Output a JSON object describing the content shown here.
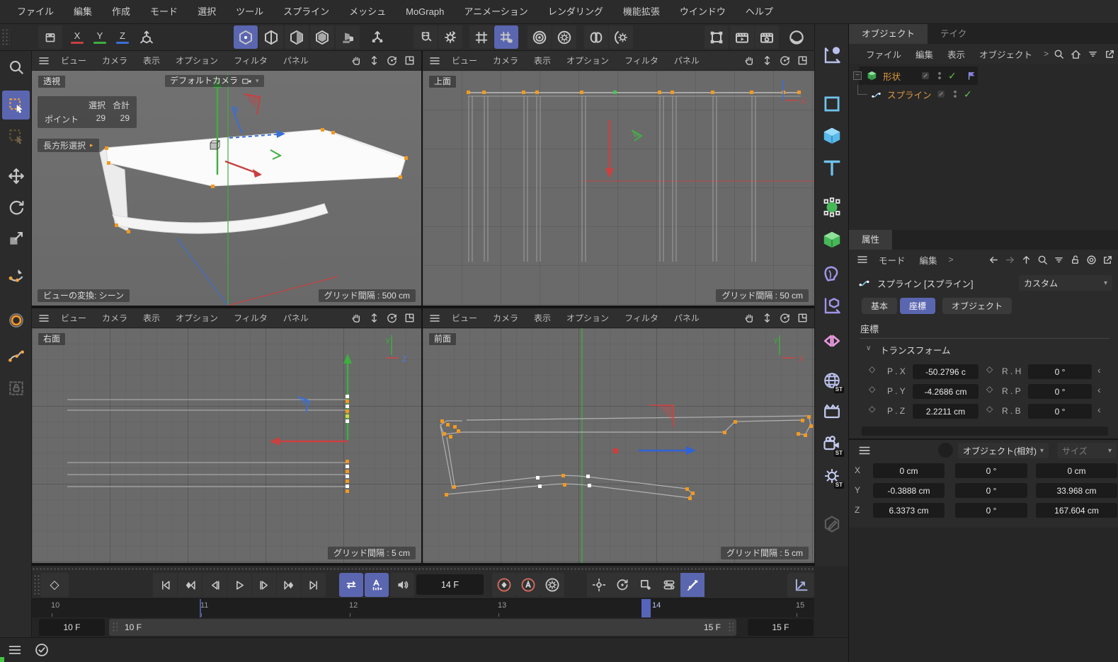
{
  "menubar": {
    "items": [
      "ファイル",
      "編集",
      "作成",
      "モード",
      "選択",
      "ツール",
      "スプライン",
      "メッシュ",
      "MoGraph",
      "アニメーション",
      "レンダリング",
      "機能拡張",
      "ウインドウ",
      "ヘルプ"
    ]
  },
  "viewport_menu": {
    "items": [
      "ビュー",
      "カメラ",
      "表示",
      "オプション",
      "フィルタ",
      "パネル"
    ]
  },
  "viewports": {
    "persp": {
      "label": "透視",
      "camera_label": "デフォルトカメラ",
      "hud_col1": "選択",
      "hud_col2": "合計",
      "hud_row_label": "ポイント",
      "hud_selected": "29",
      "hud_total": "29",
      "tool_label": "長方形選択",
      "status_left": "ビューの変換: シーン",
      "grid_label": "グリッド間隔 : 500 cm"
    },
    "top": {
      "label": "上面",
      "grid_label": "グリッド間隔 : 50 cm"
    },
    "right": {
      "label": "右面",
      "grid_label": "グリッド間隔 : 5 cm"
    },
    "front": {
      "label": "前面",
      "grid_label": "グリッド間隔 : 5 cm"
    },
    "gizmo": {
      "x": "X",
      "y": "Y",
      "z": "Z"
    }
  },
  "object_manager": {
    "tabs": [
      "オブジェクト",
      "テイク"
    ],
    "menu": [
      "ファイル",
      "編集",
      "表示",
      "オブジェクト"
    ],
    "objects": [
      {
        "name": "形状"
      },
      {
        "name": "スプライン"
      }
    ]
  },
  "attribute_manager": {
    "tab": "属性",
    "menu": [
      "モード",
      "編集"
    ],
    "object_title": "スプライン [スプライン]",
    "preset": "カスタム",
    "tabs": [
      "基本",
      "座標",
      "オブジェクト"
    ],
    "active_tab": "座標",
    "section_title": "座標",
    "group_title": "トランスフォーム",
    "pos": [
      {
        "label": "P . X",
        "value": "-50.2796 c"
      },
      {
        "label": "P . Y",
        "value": "-4.2686 cm"
      },
      {
        "label": "P . Z",
        "value": "2.2211 cm"
      }
    ],
    "rot": [
      {
        "label": "R . H",
        "value": "0 °"
      },
      {
        "label": "R . P",
        "value": "0 °"
      },
      {
        "label": "R . B",
        "value": "0 °"
      }
    ]
  },
  "coord_manager": {
    "mode_dropdown": "オブジェクト(相対)",
    "size_dropdown": "サイズ",
    "rows": [
      {
        "axis": "X",
        "position": "0 cm",
        "rotation": "0 °",
        "scale": "0 cm"
      },
      {
        "axis": "Y",
        "position": "-0.3888 cm",
        "rotation": "0 °",
        "scale": "33.968 cm"
      },
      {
        "axis": "Z",
        "position": "6.3373 cm",
        "rotation": "0 °",
        "scale": "167.604 cm"
      }
    ]
  },
  "timeline": {
    "current_frame": "14 F",
    "ticks": [
      "10",
      "11",
      "12",
      "13",
      "14",
      "15"
    ],
    "range_start_field": "10 F",
    "range_end_field": "15 F",
    "range_bar_start": "10 F",
    "range_bar_end": "15 F"
  },
  "badges": {
    "st": "ST"
  },
  "glyphs": {
    "caret_down": "▾",
    "chevron_right": ">",
    "spinner_left": "‹",
    "check": "✓",
    "diamond": "◇",
    "section_caret": "∨",
    "minus": "−",
    "sub_arrow": "▸"
  },
  "colors": {
    "accent": "#5b66b0",
    "axis_x": "#c84040",
    "axis_y": "#3fae3f",
    "axis_z": "#3a6fd6",
    "selection_orange": "#f29a1e",
    "object_name": "#e09a3e",
    "check_green": "#6abf4b"
  }
}
